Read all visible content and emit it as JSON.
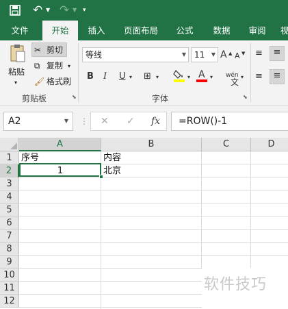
{
  "quick_access": {
    "save_icon": "save-icon",
    "undo_icon": "undo-icon",
    "redo_icon": "redo-icon",
    "more_icon": "customize-qat-icon"
  },
  "tabs": [
    "文件",
    "开始",
    "插入",
    "页面布局",
    "公式",
    "数据",
    "审阅",
    "视"
  ],
  "active_tab": "开始",
  "ribbon": {
    "clipboard": {
      "paste_label": "粘贴",
      "cut_label": "剪切",
      "copy_label": "复制",
      "format_painter_label": "格式刷",
      "group_label": "剪贴板"
    },
    "font": {
      "font_name": "等线",
      "font_size": "11",
      "increase_size": "A",
      "decrease_size": "A",
      "bold": "B",
      "italic": "I",
      "underline": "U",
      "phonetic": "wén",
      "group_label": "字体",
      "fill_color": "#ffff00",
      "font_color": "#ff0000"
    }
  },
  "formula_bar": {
    "name_box": "A2",
    "cancel": "✕",
    "enter": "✓",
    "fx": "fx",
    "formula": "=ROW()-1"
  },
  "grid": {
    "columns": [
      "A",
      "B",
      "C",
      "D"
    ],
    "selected_column": "A",
    "rows": [
      "1",
      "2",
      "3",
      "4",
      "5",
      "6",
      "7",
      "8",
      "9",
      "10",
      "11",
      "12"
    ],
    "selected_row": "2",
    "cells": {
      "A1": "序号",
      "B1": "内容",
      "A2": "1",
      "B2": "北京"
    }
  },
  "accent_color": "#217346",
  "watermark": "软件技巧"
}
